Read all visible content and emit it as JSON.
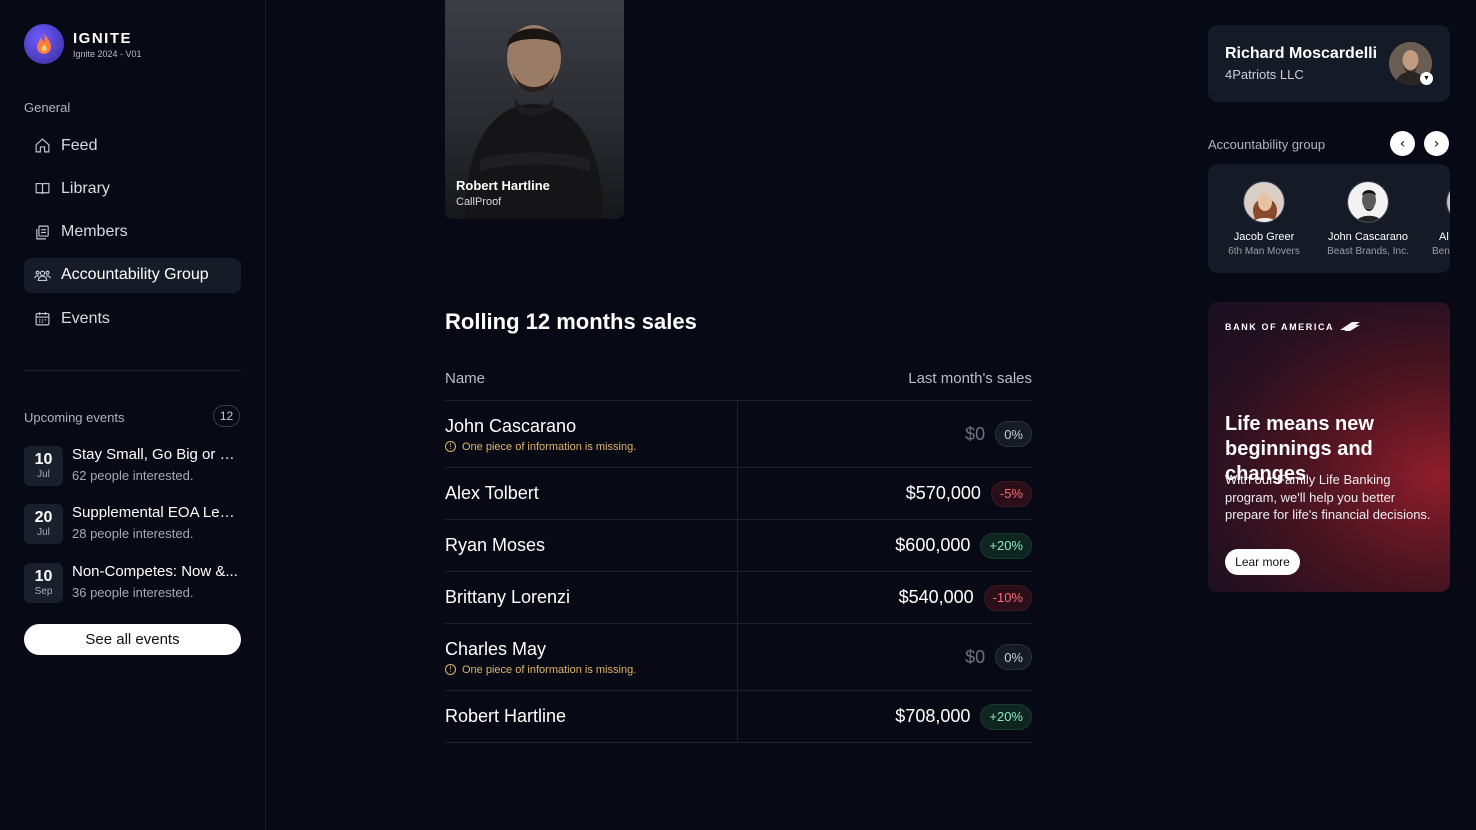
{
  "brand": {
    "name": "IGNITE",
    "subtitle": "Ignite 2024 - V01"
  },
  "sidebar": {
    "section_label": "General",
    "items": [
      {
        "label": "Feed",
        "icon": "home-icon"
      },
      {
        "label": "Library",
        "icon": "book-icon"
      },
      {
        "label": "Members",
        "icon": "members-icon"
      },
      {
        "label": "Accountability Group",
        "icon": "group-icon",
        "active": true
      },
      {
        "label": "Events",
        "icon": "calendar-icon"
      }
    ],
    "upcoming_label": "Upcoming events",
    "upcoming_count": "12",
    "events": [
      {
        "day": "10",
        "month": "Jul",
        "title": "Stay Small, Go Big or Se...",
        "interest": "62 people interested."
      },
      {
        "day": "20",
        "month": "Jul",
        "title": "Supplemental EOA Lear...",
        "interest": "28 people interested."
      },
      {
        "day": "10",
        "month": "Sep",
        "title": "Non-Competes: Now &...",
        "interest": "36 people interested."
      }
    ],
    "see_all_label": "See all events"
  },
  "profile_card": {
    "name": "Robert Hartline",
    "company": "CallProof"
  },
  "sales": {
    "title": "Rolling 12 months sales",
    "col_name": "Name",
    "col_sales": "Last month's sales",
    "missing_text": "One piece of information is missing.",
    "rows": [
      {
        "name": "John Cascarano",
        "amount": "$0",
        "change": "0%",
        "trend": "neutral",
        "missing": true
      },
      {
        "name": "Alex Tolbert",
        "amount": "$570,000",
        "change": "-5%",
        "trend": "neg",
        "missing": false
      },
      {
        "name": "Ryan Moses",
        "amount": "$600,000",
        "change": "+20%",
        "trend": "pos",
        "missing": false
      },
      {
        "name": "Brittany Lorenzi",
        "amount": "$540,000",
        "change": "-10%",
        "trend": "neg",
        "missing": false
      },
      {
        "name": "Charles May",
        "amount": "$0",
        "change": "0%",
        "trend": "neutral",
        "missing": true
      },
      {
        "name": "Robert Hartline",
        "amount": "$708,000",
        "change": "+20%",
        "trend": "pos",
        "missing": false
      }
    ]
  },
  "user": {
    "name": "Richard Moscardelli",
    "company": "4Patriots LLC"
  },
  "accountability": {
    "label": "Accountability group",
    "members": [
      {
        "name": "Jacob Greer",
        "company": "6th Man Movers"
      },
      {
        "name": "John Cascarano",
        "company": "Beast Brands, Inc."
      },
      {
        "name": "Al",
        "company": "Ben"
      }
    ]
  },
  "ad": {
    "logo": "BANK OF AMERICA",
    "headline": "Life means new beginnings and changes",
    "body": "With our Family Life Banking program, we'll help you better prepare for life's financial decisions.",
    "button": "Lear more"
  },
  "colors": {
    "accent": "#6d5cff",
    "positive": "#8fe6c2",
    "negative": "#ff6b7c",
    "warning": "#e0b46a"
  }
}
